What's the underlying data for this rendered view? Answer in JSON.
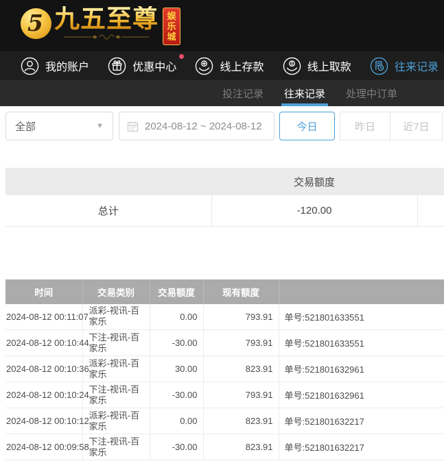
{
  "brand": {
    "name": "九五至尊",
    "badge": "娱乐城",
    "monogram": "5",
    "colors": {
      "gold": "#f4b62b",
      "seal_red": "#c72a1e",
      "seal_text": "#ffd23e",
      "bar_bg": "#131313"
    }
  },
  "nav": {
    "accent": "#4da0d8",
    "items": [
      {
        "label": "我的账户",
        "icon": "user-icon",
        "active": false
      },
      {
        "label": "优惠中心",
        "icon": "gift-icon",
        "active": false,
        "notification_dot": true,
        "dot_color": "#e8506b"
      },
      {
        "label": "线上存款",
        "icon": "deposit-hand-coin-icon",
        "active": false
      },
      {
        "label": "线上取款",
        "icon": "withdraw-hand-coin-icon",
        "active": false
      },
      {
        "label": "往来记录",
        "icon": "transaction-records-icon",
        "active": true
      }
    ]
  },
  "tabs": {
    "underline_color": "#4da0d8",
    "items": [
      {
        "label": "投注记录",
        "active": false
      },
      {
        "label": "往来记录",
        "active": true
      },
      {
        "label": "处理中订单",
        "active": false
      }
    ]
  },
  "filters": {
    "type_select": {
      "value": "全部",
      "icon": "dropdown-caret-icon"
    },
    "date_range": {
      "value": "2024-08-12 ~ 2024-08-12",
      "icon": "calendar-icon"
    },
    "quick_buttons": [
      {
        "label": "今日",
        "active": true
      },
      {
        "label": "昨日",
        "active": false
      },
      {
        "label": "近7日",
        "active": false
      }
    ]
  },
  "summary": {
    "header": "交易额度",
    "row_label": "总计",
    "total": "-120.00"
  },
  "table": {
    "headers": [
      "时间",
      "交易类别",
      "交易额度",
      "现有额度",
      ""
    ],
    "rows": [
      {
        "time": "2024-08-12 00:11:07",
        "type": "派彩-视讯-百家乐",
        "amount": "0.00",
        "balance": "793.91",
        "order": "单号:521801633551"
      },
      {
        "time": "2024-08-12 00:10:44",
        "type": "下注-视讯-百家乐",
        "amount": "-30.00",
        "balance": "793.91",
        "order": "单号:521801633551"
      },
      {
        "time": "2024-08-12 00:10:36",
        "type": "派彩-视讯-百家乐",
        "amount": "30.00",
        "balance": "823.91",
        "order": "单号:521801632961"
      },
      {
        "time": "2024-08-12 00:10:24",
        "type": "下注-视讯-百家乐",
        "amount": "-30.00",
        "balance": "793.91",
        "order": "单号:521801632961"
      },
      {
        "time": "2024-08-12 00:10:12",
        "type": "派彩-视讯-百家乐",
        "amount": "0.00",
        "balance": "823.91",
        "order": "单号:521801632217"
      },
      {
        "time": "2024-08-12 00:09:58",
        "type": "下注-视讯-百家乐",
        "amount": "-30.00",
        "balance": "823.91",
        "order": "单号:521801632217"
      }
    ]
  }
}
